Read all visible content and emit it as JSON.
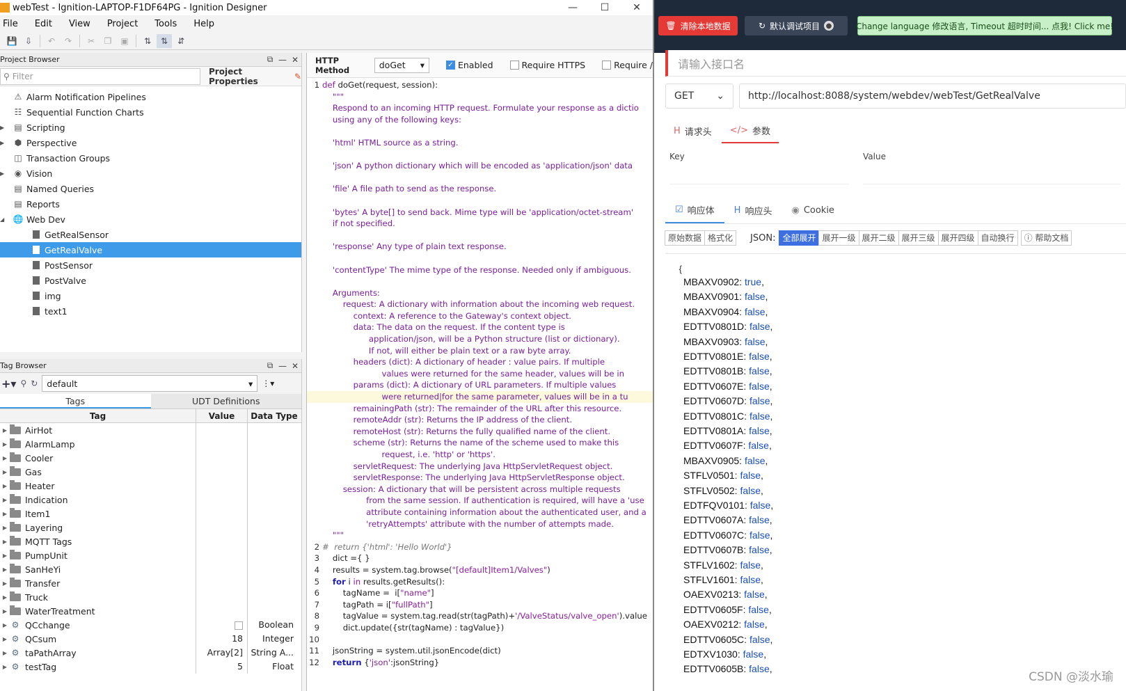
{
  "designer": {
    "window_title": "webTest - Ignition-LAPTOP-F1DF64PG - Ignition Designer",
    "menus": [
      "File",
      "Edit",
      "View",
      "Project",
      "Tools",
      "Help"
    ],
    "project_browser": {
      "title": "Project Browser",
      "filter_placeholder": "Filter",
      "project_properties": "Project Properties",
      "items": [
        {
          "label": "Alarm Notification Pipelines",
          "icon": "alarm-pipeline-icon",
          "expandable": false,
          "level": 0
        },
        {
          "label": "Sequential Function Charts",
          "icon": "sfc-icon",
          "expandable": false,
          "level": 0
        },
        {
          "label": "Scripting",
          "icon": "scripting-icon",
          "expandable": true,
          "level": 0
        },
        {
          "label": "Perspective",
          "icon": "perspective-icon",
          "expandable": true,
          "level": 0
        },
        {
          "label": "Transaction Groups",
          "icon": "transaction-groups-icon",
          "expandable": false,
          "level": 0
        },
        {
          "label": "Vision",
          "icon": "vision-icon",
          "expandable": true,
          "level": 0
        },
        {
          "label": "Named Queries",
          "icon": "named-queries-icon",
          "expandable": false,
          "level": 0
        },
        {
          "label": "Reports",
          "icon": "reports-icon",
          "expandable": false,
          "level": 0
        },
        {
          "label": "Web Dev",
          "icon": "web-dev-icon",
          "expandable": true,
          "expanded": true,
          "level": 0
        },
        {
          "label": "GetRealSensor",
          "icon": "document-icon",
          "level": 1
        },
        {
          "label": "GetRealValve",
          "icon": "document-icon",
          "level": 1,
          "selected": true
        },
        {
          "label": "PostSensor",
          "icon": "document-icon",
          "level": 1
        },
        {
          "label": "PostValve",
          "icon": "document-icon",
          "level": 1
        },
        {
          "label": "img",
          "icon": "document-icon",
          "level": 1
        },
        {
          "label": "text1",
          "icon": "document-icon",
          "level": 1
        }
      ]
    },
    "tag_browser": {
      "title": "Tag Browser",
      "provider": "default",
      "tabs": [
        "Tags",
        "UDT Definitions"
      ],
      "columns": [
        "Tag",
        "Value",
        "Data Type"
      ],
      "rows": [
        {
          "name": "AirHot",
          "type": "folder",
          "value": "",
          "data_type": ""
        },
        {
          "name": "AlarmLamp",
          "type": "folder",
          "value": "",
          "data_type": ""
        },
        {
          "name": "Cooler",
          "type": "folder",
          "value": "",
          "data_type": ""
        },
        {
          "name": "Gas",
          "type": "folder",
          "value": "",
          "data_type": ""
        },
        {
          "name": "Heater",
          "type": "folder",
          "value": "",
          "data_type": ""
        },
        {
          "name": "Indication",
          "type": "folder",
          "value": "",
          "data_type": ""
        },
        {
          "name": "Item1",
          "type": "folder",
          "value": "",
          "data_type": ""
        },
        {
          "name": "Layering",
          "type": "folder",
          "value": "",
          "data_type": ""
        },
        {
          "name": "MQTT Tags",
          "type": "folder",
          "value": "",
          "data_type": ""
        },
        {
          "name": "PumpUnit",
          "type": "folder",
          "value": "",
          "data_type": ""
        },
        {
          "name": "SanHeYi",
          "type": "folder",
          "value": "",
          "data_type": ""
        },
        {
          "name": "Transfer",
          "type": "folder",
          "value": "",
          "data_type": ""
        },
        {
          "name": "Truck",
          "type": "folder",
          "value": "",
          "data_type": ""
        },
        {
          "name": "WaterTreatment",
          "type": "folder",
          "value": "",
          "data_type": ""
        },
        {
          "name": "QCchange",
          "type": "tag",
          "value": "",
          "checkbox": true,
          "data_type": "Boolean"
        },
        {
          "name": "QCsum",
          "type": "tag",
          "value": "18",
          "data_type": "Integer"
        },
        {
          "name": "taPathArray",
          "type": "tag",
          "value": "Array[2]",
          "data_type": "String A..."
        },
        {
          "name": "testTag",
          "type": "tag",
          "value": "5",
          "data_type": "Float"
        }
      ]
    },
    "editor": {
      "http_method_label": "HTTP Method",
      "http_method": "doGet",
      "enabled_label": "Enabled",
      "enabled": true,
      "require_https_label": "Require HTTPS",
      "require_auth_label": "Require /",
      "lines": [
        {
          "n": "1",
          "cls": "",
          "html": "<span class='kw' style='color:#8a1f9a;font-weight:normal'>def</span> doGet(request, session):"
        },
        {
          "n": "",
          "cls": "doc",
          "html": "    \"\"\""
        },
        {
          "n": "",
          "cls": "doc",
          "html": "    Respond to an incoming HTTP request. Formulate your response as a dictio"
        },
        {
          "n": "",
          "cls": "doc",
          "html": "    using any of the following keys:"
        },
        {
          "n": "",
          "cls": "doc",
          "html": ""
        },
        {
          "n": "",
          "cls": "doc",
          "html": "    'html' HTML source as a string."
        },
        {
          "n": "",
          "cls": "doc",
          "html": ""
        },
        {
          "n": "",
          "cls": "doc",
          "html": "    'json' A python dictionary which will be encoded as 'application/json' data"
        },
        {
          "n": "",
          "cls": "doc",
          "html": ""
        },
        {
          "n": "",
          "cls": "doc",
          "html": "    'file' A file path to send as the response."
        },
        {
          "n": "",
          "cls": "doc",
          "html": ""
        },
        {
          "n": "",
          "cls": "doc",
          "html": "    'bytes' A byte[] to send back. Mime type will be 'application/octet-stream'"
        },
        {
          "n": "",
          "cls": "doc",
          "html": "    if not specified."
        },
        {
          "n": "",
          "cls": "doc",
          "html": ""
        },
        {
          "n": "",
          "cls": "doc",
          "html": "    'response' Any type of plain text response."
        },
        {
          "n": "",
          "cls": "doc",
          "html": ""
        },
        {
          "n": "",
          "cls": "doc",
          "html": "    'contentType' The mime type of the response. Needed only if ambiguous."
        },
        {
          "n": "",
          "cls": "doc",
          "html": ""
        },
        {
          "n": "",
          "cls": "doc",
          "html": "    Arguments:"
        },
        {
          "n": "",
          "cls": "doc",
          "html": "        request: A dictionary with information about the incoming web request."
        },
        {
          "n": "",
          "cls": "doc",
          "html": "            context: A reference to the Gateway's context object."
        },
        {
          "n": "",
          "cls": "doc",
          "html": "            data: The data on the request. If the content type is"
        },
        {
          "n": "",
          "cls": "doc",
          "html": "                  application/json, will be a Python structure (list or dictionary)."
        },
        {
          "n": "",
          "cls": "doc",
          "html": "                  If not, will either be plain text or a raw byte array."
        },
        {
          "n": "",
          "cls": "doc",
          "html": "            headers (dict): A dictionary of header : value pairs. If multiple"
        },
        {
          "n": "",
          "cls": "doc",
          "html": "                       values were returned for the same header, values will be in"
        },
        {
          "n": "",
          "cls": "doc",
          "html": "            params (dict): A dictionary of URL parameters. If multiple values"
        },
        {
          "n": "",
          "cls": "doc hl",
          "html": "                       were returned|for the same parameter, values will be in a tu"
        },
        {
          "n": "",
          "cls": "doc",
          "html": "            remainingPath (str): The remainder of the URL after this resource."
        },
        {
          "n": "",
          "cls": "doc",
          "html": "            remoteAddr (str): Returns the IP address of the client."
        },
        {
          "n": "",
          "cls": "doc",
          "html": "            remoteHost (str): Returns the fully qualified name of the client."
        },
        {
          "n": "",
          "cls": "doc",
          "html": "            scheme (str): Returns the name of the scheme used to make this"
        },
        {
          "n": "",
          "cls": "doc",
          "html": "                       request, i.e. 'http' or 'https'."
        },
        {
          "n": "",
          "cls": "doc",
          "html": "            servletRequest: The underlying Java HttpServletRequest object."
        },
        {
          "n": "",
          "cls": "doc",
          "html": "            servletResponse: The underlying Java HttpServletResponse object."
        },
        {
          "n": "",
          "cls": "doc",
          "html": "        session: A dictionary that will be persistent across multiple requests"
        },
        {
          "n": "",
          "cls": "doc",
          "html": "                 from the same session. If authentication is required, will have a 'use"
        },
        {
          "n": "",
          "cls": "doc",
          "html": "                 attribute containing information about the authenticated user, and a"
        },
        {
          "n": "",
          "cls": "doc",
          "html": "                 'retryAttempts' attribute with the number of attempts made."
        },
        {
          "n": "",
          "cls": "doc",
          "html": "    \"\"\""
        },
        {
          "n": "2",
          "cls": "comment",
          "html": "#  return {'html': '<html><body>Hello World</body></html>'}"
        },
        {
          "n": "3",
          "cls": "",
          "html": "    dict ={ }"
        },
        {
          "n": "4",
          "cls": "",
          "html": "    results = system.tag.browse(<span class='str'>\"[default]Item1/Valves\"</span>)"
        },
        {
          "n": "5",
          "cls": "",
          "html": "    <span class='kw'>for</span> i <span class='kw' style='font-weight:normal;color:#8a1f9a'>in</span> results.getResults():"
        },
        {
          "n": "6",
          "cls": "",
          "html": "        tagName =  i[<span class='str'>\"name\"</span>]"
        },
        {
          "n": "7",
          "cls": "",
          "html": "        tagPath = i[<span class='str'>\"fullPath\"</span>]"
        },
        {
          "n": "8",
          "cls": "",
          "html": "        tagValue = system.tag.read(str(tagPath)+<span class='str'>'/ValveStatus/valve_open'</span>).value"
        },
        {
          "n": "9",
          "cls": "",
          "html": "        dict.update({str(tagName) : tagValue})"
        },
        {
          "n": "10",
          "cls": "",
          "html": ""
        },
        {
          "n": "11",
          "cls": "",
          "html": "    jsonString = system.util.jsonEncode(dict)"
        },
        {
          "n": "12",
          "cls": "",
          "html": "    <span class='kw'>return</span> {<span class='str'>'json'</span>:jsonString}"
        }
      ]
    }
  },
  "tester": {
    "btn_clear": "清除本地数据",
    "btn_default": "默认调试项目",
    "btn_lang": "Change language 修改语言, Timeout 超时时间... 点我!  Click me!",
    "interface_placeholder": "请输入接口名",
    "method": "GET",
    "url": "http://localhost:8088/system/webdev/webTest/GetRealValve",
    "req_tabs": [
      "请求头",
      "参数"
    ],
    "kv_key": "Key",
    "kv_value": "Value",
    "resp_tabs": [
      "响应体",
      "响应头",
      "Cookie"
    ],
    "json_tools_left": [
      "原始数据",
      "格式化"
    ],
    "json_label": "JSON:",
    "json_tools_right": [
      "全部展开",
      "展开一级",
      "展开二级",
      "展开三级",
      "展开四级",
      "自动换行"
    ],
    "help": "帮助文档",
    "open_brace": "{",
    "json_entries": [
      {
        "k": "MBAXV0902",
        "v": "true"
      },
      {
        "k": "MBAXV0901",
        "v": "false"
      },
      {
        "k": "MBAXV0904",
        "v": "false"
      },
      {
        "k": "EDTTV0801D",
        "v": "false"
      },
      {
        "k": "MBAXV0903",
        "v": "false"
      },
      {
        "k": "EDTTV0801E",
        "v": "false"
      },
      {
        "k": "EDTTV0801B",
        "v": "false"
      },
      {
        "k": "EDTTV0607E",
        "v": "false"
      },
      {
        "k": "EDTTV0607D",
        "v": "false"
      },
      {
        "k": "EDTTV0801C",
        "v": "false"
      },
      {
        "k": "EDTTV0801A",
        "v": "false"
      },
      {
        "k": "EDTTV0607F",
        "v": "false"
      },
      {
        "k": "MBAXV0905",
        "v": "false"
      },
      {
        "k": "STFLV0501",
        "v": "false"
      },
      {
        "k": "STFLV0502",
        "v": "false"
      },
      {
        "k": "EDTFQV0101",
        "v": "false"
      },
      {
        "k": "EDTTV0607A",
        "v": "false"
      },
      {
        "k": "EDTTV0607C",
        "v": "false"
      },
      {
        "k": "EDTTV0607B",
        "v": "false"
      },
      {
        "k": "STFLV1602",
        "v": "false"
      },
      {
        "k": "STFLV1601",
        "v": "false"
      },
      {
        "k": "OAEXV0213",
        "v": "false"
      },
      {
        "k": "EDTTV0605F",
        "v": "false"
      },
      {
        "k": "OAEXV0212",
        "v": "false"
      },
      {
        "k": "EDTTV0605C",
        "v": "false"
      },
      {
        "k": "EDTXV1030",
        "v": "false"
      },
      {
        "k": "EDTTV0605B",
        "v": "false"
      }
    ],
    "watermark": "CSDN @淡水瑜"
  }
}
